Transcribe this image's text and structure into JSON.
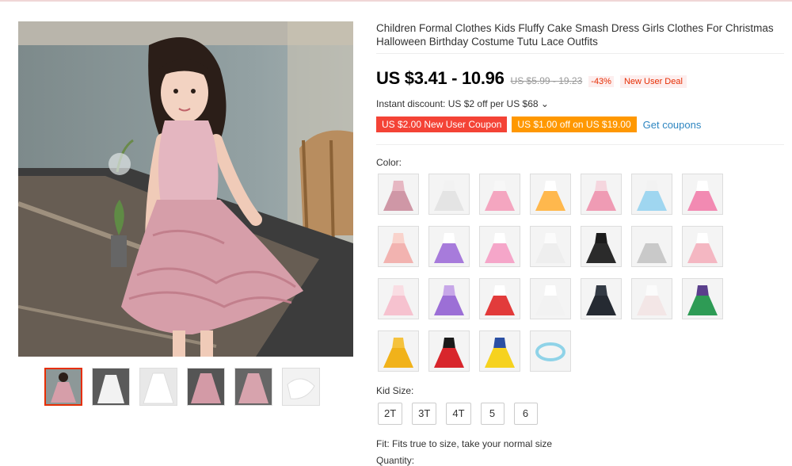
{
  "product": {
    "title": "Children Formal Clothes Kids Fluffy Cake Smash Dress Girls Clothes For Christmas Halloween Birthday Costume Tutu Lace Outfits",
    "price": "US $3.41 - 10.96",
    "original_price": "US $5.99 - 19.23",
    "discount": "-43%",
    "deal_badge": "New User Deal",
    "instant_discount": "Instant discount: US $2 off per US $68 ⌄",
    "coupon_1": "US $2.00 New User Coupon",
    "coupon_2": "US $1.00 off on US $19.00",
    "get_coupons": "Get coupons"
  },
  "color_label": "Color:",
  "colors": [
    {
      "name": "pink-tutu",
      "body": "#e6b7c2",
      "skirt": "#cf97a6"
    },
    {
      "name": "white-tutu",
      "body": "#f2f2f2",
      "skirt": "#e4e4e4"
    },
    {
      "name": "rainbow-heart",
      "body": "#f7f7f7",
      "skirt": "#f4a6c0"
    },
    {
      "name": "rainbow-print",
      "body": "#ffffff",
      "skirt": "#ffb84d"
    },
    {
      "name": "pink-unicorn",
      "body": "#f5d6de",
      "skirt": "#ef9bb4"
    },
    {
      "name": "rainbow-unicorn",
      "body": "#f2f2f2",
      "skirt": "#9fd6f0"
    },
    {
      "name": "unicorn-rainbow-2",
      "body": "#ffffff",
      "skirt": "#f28ab2"
    },
    {
      "name": "peach-tutu",
      "body": "#f9d3cc",
      "skirt": "#f2b3b0"
    },
    {
      "name": "purple-tutu",
      "body": "#ffffff",
      "skirt": "#a77bdb"
    },
    {
      "name": "rainbow-tutu",
      "body": "#ffffff",
      "skirt": "#f5a6c9"
    },
    {
      "name": "white-lace",
      "body": "#fbfbfb",
      "skirt": "#eeeeee"
    },
    {
      "name": "black-dress",
      "body": "#1c1c1c",
      "skirt": "#2b2b2b"
    },
    {
      "name": "grey-tutu",
      "body": "#f4f4f4",
      "skirt": "#c9c9c9"
    },
    {
      "name": "pink-tutu-2",
      "body": "#ffffff",
      "skirt": "#f4b7c2"
    },
    {
      "name": "light-pink",
      "body": "#f9dde3",
      "skirt": "#f6c2cf"
    },
    {
      "name": "lilac",
      "body": "#c7a7e8",
      "skirt": "#9c6fd6"
    },
    {
      "name": "red",
      "body": "#ffffff",
      "skirt": "#e23b3b"
    },
    {
      "name": "white-2",
      "body": "#ffffff",
      "skirt": "#f2f2f2"
    },
    {
      "name": "black-star",
      "body": "#333a44",
      "skirt": "#252a32"
    },
    {
      "name": "white-strawberry",
      "body": "#fbfbfb",
      "skirt": "#f3e6e6"
    },
    {
      "name": "green-princess",
      "body": "#5a3f8c",
      "skirt": "#2e9b55"
    },
    {
      "name": "belle-yellow",
      "body": "#f5c23d",
      "skirt": "#f1b21a"
    },
    {
      "name": "minnie-red",
      "body": "#1a1a1a",
      "skirt": "#d8262c"
    },
    {
      "name": "snow-white",
      "body": "#2b4fa3",
      "skirt": "#f6d21f"
    },
    {
      "name": "flower-crown",
      "body": "#ffffff",
      "skirt": "#ffffff"
    }
  ],
  "kid_size_label": "Kid Size:",
  "sizes": [
    "2T",
    "3T",
    "4T",
    "5",
    "6"
  ],
  "fit_text": "Fit: Fits true to size, take your normal size",
  "quantity_label": "Quantity:"
}
